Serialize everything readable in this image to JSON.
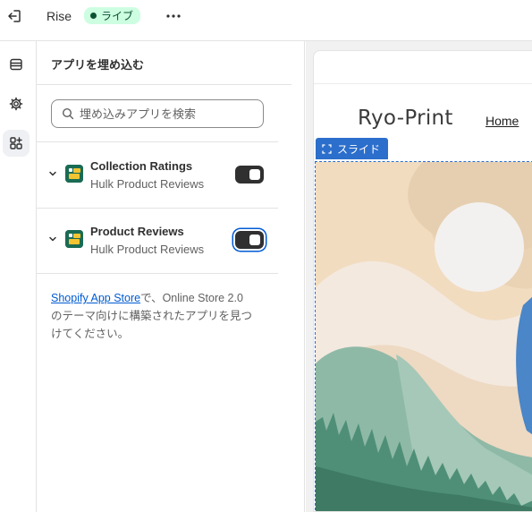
{
  "topbar": {
    "theme_name": "Rise",
    "live_label": "ライブ"
  },
  "panel": {
    "title": "アプリを埋め込む",
    "search_placeholder": "埋め込みアプリを検索",
    "apps": [
      {
        "name": "Collection Ratings",
        "vendor": "Hulk Product Reviews",
        "enabled": true
      },
      {
        "name": "Product Reviews",
        "vendor": "Hulk Product Reviews",
        "enabled": true
      }
    ],
    "help_link": "Shopify App Store",
    "help_text_1": "で、Online Store 2.0",
    "help_text_2": "のテーマ向けに構築されたアプリを見つ",
    "help_text_3": "けてください。"
  },
  "preview": {
    "store_name": "Ryo-Print",
    "nav_home": "Home",
    "section_label": "スライド"
  },
  "colors": {
    "accent": "#005bd3",
    "live_bg": "#cdfee1",
    "section_blue": "#2c6ecb",
    "toggle_on": "#303030"
  },
  "icons": {
    "exit": "exit-icon",
    "more": "more-horizontal-icon",
    "sections": "sections-icon",
    "settings": "gear-icon",
    "apps": "apps-icon",
    "search": "search-icon",
    "chevron": "chevron-down-icon",
    "slide": "slideshow-icon"
  }
}
